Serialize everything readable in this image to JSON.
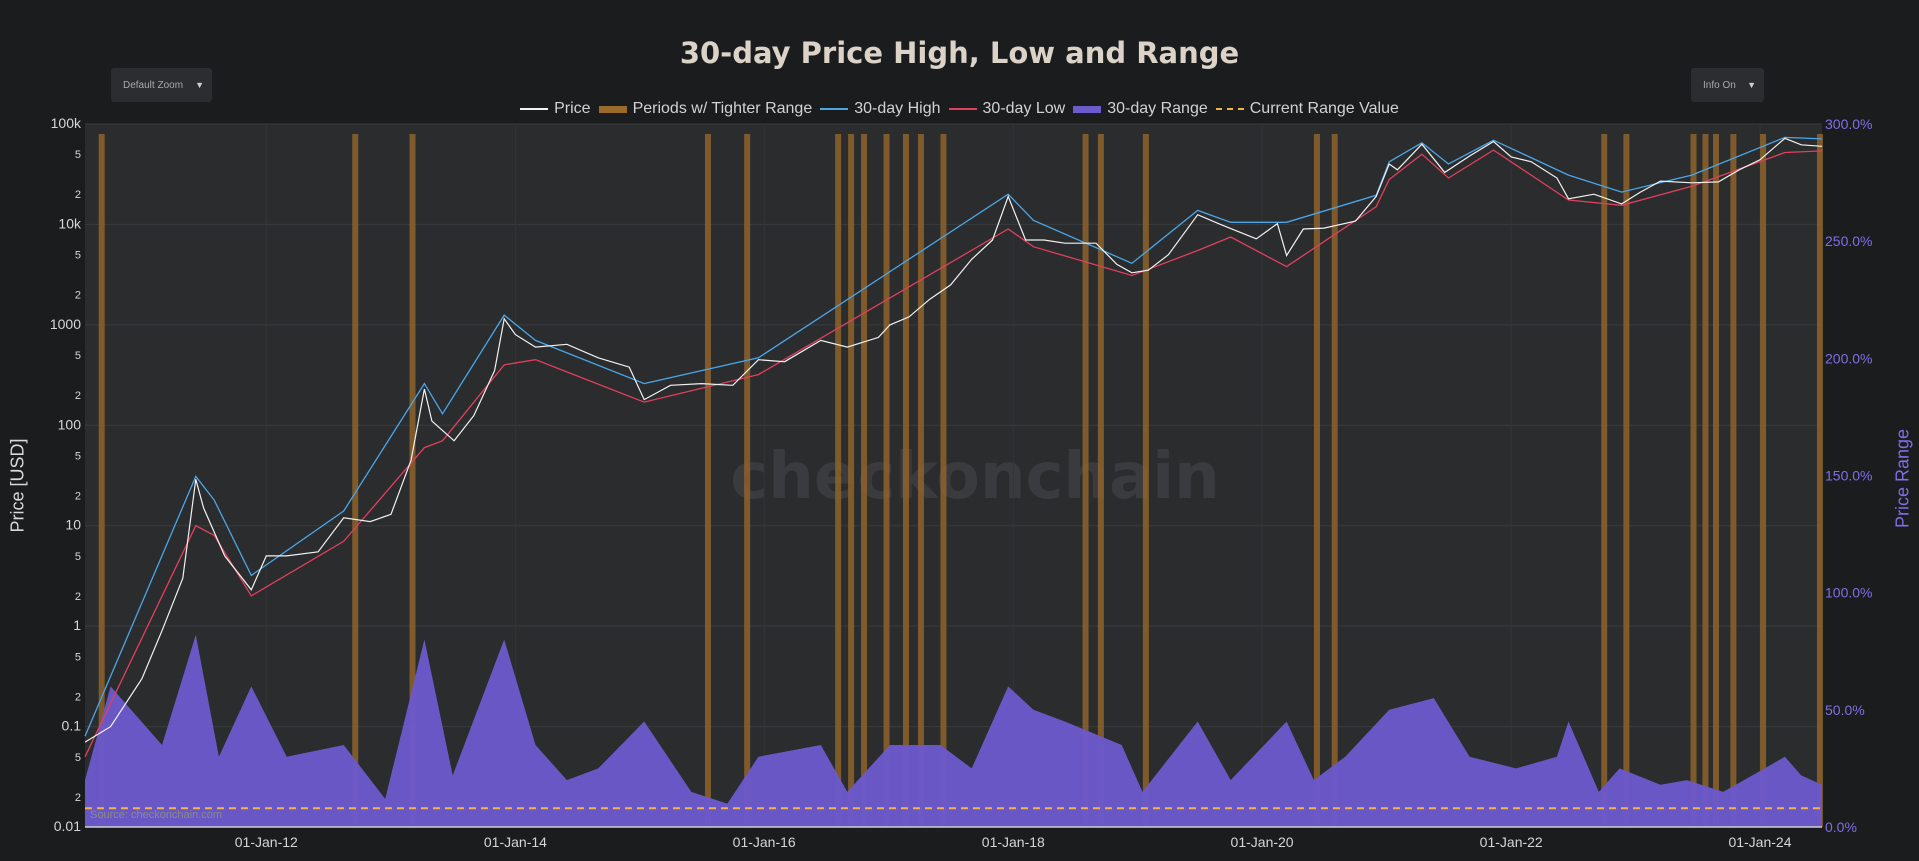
{
  "page": {
    "title": "30-day Price High, Low and Range",
    "zoom_dropdown": "Default Zoom",
    "info_dropdown": "Info On",
    "watermark": "checkonchain",
    "source": "Source: checkonchain.com"
  },
  "colors": {
    "background": "#1b1c1e",
    "plot_bg": "#2b2c2e",
    "price": "#f2f2f2",
    "high": "#4aa6e8",
    "low": "#e0405e",
    "range": "#6d5acd",
    "tighter": "#9c6a2a",
    "current": "#f5b342",
    "right_axis": "#7e6fe6"
  },
  "chart_data": {
    "type": "line",
    "title": "30-day Price High, Low and Range",
    "legend": [
      "Price",
      "Periods w/ Tighter Range",
      "30-day High",
      "30-day Low",
      "30-day Range",
      "Current Range Value"
    ],
    "legend_position": "top-center",
    "x_ticks": [
      "01-Jan-12",
      "01-Jan-14",
      "01-Jan-16",
      "01-Jan-18",
      "01-Jan-20",
      "01-Jan-22",
      "01-Jan-24"
    ],
    "x_range": [
      "2010-07-18",
      "2024-07-01"
    ],
    "y_left": {
      "label": "Price [USD]",
      "scale": "log",
      "range": [
        0.01,
        100000
      ],
      "tick_labels": [
        "0.01",
        "2",
        "5",
        "0.1",
        "2",
        "5",
        "1",
        "2",
        "5",
        "10",
        "2",
        "5",
        "100",
        "2",
        "5",
        "1000",
        "2",
        "5",
        "10k",
        "2",
        "5",
        "100k"
      ]
    },
    "y_right": {
      "label": "Price Range",
      "range": [
        0,
        300
      ],
      "tick_labels": [
        "0.0%",
        "50.0%",
        "100.0%",
        "150.0%",
        "200.0%",
        "250.0%",
        "300.0%"
      ]
    },
    "current_range_value": 8,
    "series": [
      {
        "name": "Price",
        "x": [
          "2010-07-18",
          "2010-10-01",
          "2011-01-01",
          "2011-03-01",
          "2011-05-01",
          "2011-06-08",
          "2011-07-01",
          "2011-09-01",
          "2011-11-18",
          "2012-01-01",
          "2012-03-01",
          "2012-06-01",
          "2012-08-15",
          "2012-11-01",
          "2013-01-01",
          "2013-03-01",
          "2013-04-09",
          "2013-05-01",
          "2013-07-05",
          "2013-09-01",
          "2013-11-01",
          "2013-11-29",
          "2014-01-01",
          "2014-03-01",
          "2014-06-01",
          "2014-09-01",
          "2014-12-01",
          "2015-01-14",
          "2015-04-01",
          "2015-07-01",
          "2015-10-01",
          "2015-12-15",
          "2016-03-01",
          "2016-06-15",
          "2016-09-01",
          "2016-12-01",
          "2017-01-04",
          "2017-03-01",
          "2017-05-01",
          "2017-07-01",
          "2017-09-01",
          "2017-11-01",
          "2017-12-17",
          "2018-02-06",
          "2018-04-01",
          "2018-06-01",
          "2018-09-01",
          "2018-11-01",
          "2018-12-15",
          "2019-02-01",
          "2019-04-01",
          "2019-06-26",
          "2019-09-01",
          "2019-12-15",
          "2020-02-15",
          "2020-03-13",
          "2020-05-01",
          "2020-07-01",
          "2020-10-01",
          "2020-12-01",
          "2021-01-08",
          "2021-02-01",
          "2021-04-14",
          "2021-06-20",
          "2021-09-01",
          "2021-11-10",
          "2022-01-01",
          "2022-03-01",
          "2022-05-15",
          "2022-06-18",
          "2022-09-01",
          "2022-11-21",
          "2023-01-15",
          "2023-03-15",
          "2023-06-15",
          "2023-09-01",
          "2023-11-01",
          "2024-01-01",
          "2024-03-14",
          "2024-05-01",
          "2024-07-01"
        ],
        "values": [
          0.07,
          0.1,
          0.3,
          0.9,
          3,
          29,
          15,
          5,
          2.3,
          5,
          5,
          5.5,
          12,
          11,
          13,
          45,
          230,
          110,
          70,
          125,
          350,
          1150,
          800,
          600,
          640,
          470,
          380,
          180,
          250,
          260,
          250,
          450,
          430,
          700,
          600,
          750,
          1000,
          1200,
          1800,
          2500,
          4500,
          7000,
          19000,
          7000,
          7000,
          6500,
          6500,
          4000,
          3300,
          3500,
          5000,
          12500,
          10000,
          7200,
          10200,
          4900,
          9000,
          9200,
          10800,
          19000,
          40000,
          35000,
          63000,
          33000,
          48000,
          67000,
          47000,
          42000,
          29000,
          18000,
          20000,
          16000,
          21000,
          27000,
          26000,
          26500,
          35000,
          44000,
          72000,
          62000,
          60000
        ]
      },
      {
        "name": "30-day High",
        "x": [
          "2010-07-18",
          "2011-06-08",
          "2011-08-01",
          "2011-11-18",
          "2012-08-15",
          "2013-04-09",
          "2013-06-01",
          "2013-11-29",
          "2014-03-01",
          "2015-01-14",
          "2015-12-15",
          "2017-12-17",
          "2018-03-01",
          "2018-12-15",
          "2019-06-26",
          "2019-10-01",
          "2020-03-13",
          "2020-12-01",
          "2021-01-08",
          "2021-04-14",
          "2021-07-01",
          "2021-11-10",
          "2022-06-18",
          "2022-11-21",
          "2023-06-15",
          "2024-03-14",
          "2024-07-01"
        ],
        "values": [
          0.08,
          31,
          18,
          3.2,
          14,
          260,
          130,
          1250,
          700,
          260,
          470,
          20000,
          11000,
          4100,
          13800,
          10500,
          10500,
          19500,
          42000,
          65000,
          40000,
          69000,
          31000,
          21000,
          31000,
          73500,
          71000
        ]
      },
      {
        "name": "30-day Low",
        "x": [
          "2010-07-18",
          "2011-06-08",
          "2011-08-01",
          "2011-11-18",
          "2012-08-15",
          "2013-04-09",
          "2013-06-01",
          "2013-11-29",
          "2014-03-01",
          "2015-01-14",
          "2015-12-15",
          "2017-12-17",
          "2018-03-01",
          "2018-12-15",
          "2019-06-26",
          "2019-10-01",
          "2020-03-13",
          "2020-12-01",
          "2021-01-08",
          "2021-04-14",
          "2021-07-01",
          "2021-11-10",
          "2022-06-18",
          "2022-11-21",
          "2023-06-15",
          "2024-03-14",
          "2024-07-01"
        ],
        "values": [
          0.05,
          10,
          8,
          2,
          7,
          60,
          70,
          400,
          450,
          170,
          320,
          9000,
          6000,
          3100,
          5500,
          7500,
          3800,
          15000,
          28000,
          50000,
          29000,
          55000,
          17500,
          15500,
          24000,
          52000,
          54000
        ]
      },
      {
        "name": "30-day Range",
        "x": [
          "2010-07-18",
          "2010-10-01",
          "2011-03-01",
          "2011-06-08",
          "2011-08-15",
          "2011-11-18",
          "2012-03-01",
          "2012-08-15",
          "2012-12-15",
          "2013-04-09",
          "2013-07-01",
          "2013-11-29",
          "2014-03-01",
          "2014-06-01",
          "2014-09-01",
          "2015-01-14",
          "2015-06-01",
          "2015-09-15",
          "2015-12-15",
          "2016-06-15",
          "2016-09-01",
          "2017-01-04",
          "2017-06-01",
          "2017-09-01",
          "2017-12-17",
          "2018-03-01",
          "2018-06-01",
          "2018-11-15",
          "2019-01-15",
          "2019-06-26",
          "2019-10-01",
          "2020-03-13",
          "2020-06-01",
          "2020-09-01",
          "2021-01-08",
          "2021-05-19",
          "2021-09-01",
          "2022-01-15",
          "2022-05-15",
          "2022-06-18",
          "2022-09-15",
          "2022-11-15",
          "2023-03-15",
          "2023-06-01",
          "2023-09-15",
          "2024-01-15",
          "2024-03-14",
          "2024-05-01",
          "2024-07-01"
        ],
        "values": [
          20,
          60,
          35,
          82,
          30,
          60,
          30,
          35,
          12,
          80,
          22,
          80,
          35,
          20,
          25,
          45,
          15,
          10,
          30,
          35,
          15,
          35,
          35,
          25,
          60,
          50,
          45,
          35,
          15,
          45,
          20,
          45,
          20,
          30,
          50,
          55,
          30,
          25,
          30,
          45,
          15,
          25,
          18,
          20,
          15,
          25,
          30,
          22,
          18
        ]
      },
      {
        "name": "Current Range Value",
        "x": [
          "2010-07-18",
          "2024-07-01"
        ],
        "values": [
          8,
          8
        ]
      }
    ],
    "tighter_range_periods": [
      "2010-09-05",
      "2012-09-18",
      "2013-03-05",
      "2015-07-20",
      "2015-11-12",
      "2016-08-05",
      "2016-09-12",
      "2016-10-20",
      "2016-12-25",
      "2017-02-20",
      "2017-04-05",
      "2017-06-10",
      "2018-08-01",
      "2018-09-15",
      "2019-01-25",
      "2020-06-10",
      "2020-08-01",
      "2022-10-01",
      "2022-12-05",
      "2023-06-20",
      "2023-07-25",
      "2023-08-25",
      "2023-10-15",
      "2024-01-10",
      "2024-06-25"
    ]
  }
}
